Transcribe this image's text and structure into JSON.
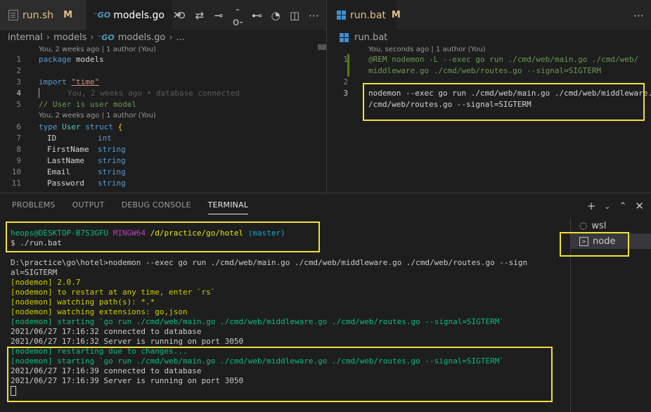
{
  "left_editor": {
    "tabs": [
      {
        "label": "run.sh",
        "mod": "M"
      },
      {
        "label": "models.go"
      }
    ],
    "toolbar_icons": [
      "history-icon",
      "compare-changes-icon",
      "git-commit-prev-icon",
      "git-commit-icon",
      "git-commit-next-icon",
      "timeline-icon",
      "split-editor-icon",
      "more-actions-icon"
    ],
    "breadcrumb": {
      "items": [
        "internal",
        "models",
        "models.go",
        "..."
      ]
    },
    "lens_top": "You, 2 weeks ago | 1 author (You)",
    "lens_mid": "You, 2 weeks ago | 1 author (You)",
    "ghost_blame": "You, 2 weeks ago • database connected",
    "line_numbers": [
      "1",
      "2",
      "3",
      "4",
      "5",
      "6",
      "7",
      "8",
      "9",
      "10",
      "11"
    ],
    "lines": {
      "l1_kw": "package",
      "l1_id": " models",
      "l3_kw": "import",
      "l3_str": "\"time\"",
      "l5_cm": "// User is user model",
      "l6_kw": "type",
      "l6_ty": " User",
      "l6_kw2": " struct",
      "l6_br": " {",
      "fields": [
        {
          "name": "ID",
          "type": "int"
        },
        {
          "name": "FirstName",
          "type": "string"
        },
        {
          "name": "LastName",
          "type": "string"
        },
        {
          "name": "Email",
          "type": "string"
        },
        {
          "name": "Password",
          "type": "string"
        }
      ]
    }
  },
  "right_editor": {
    "tab": {
      "label": "run.bat",
      "mod": "M"
    },
    "breadcrumb": "run.bat",
    "lens": "You, seconds ago | 1 author (You)",
    "line_numbers": [
      "1",
      "2",
      "3"
    ],
    "line1_a": "@REM nodemon -L --exec go run ./cmd/web/main.go ./cmd/web/",
    "line1_b": "middleware.go ./cmd/web/routes.go --signal=SIGTERM",
    "line3_a": "nodemon --exec go run ./cmd/web/main.go ./cmd/web/middleware.go .",
    "line3_b": "/cmd/web/routes.go --signal=SIGTERM"
  },
  "panel": {
    "tabs": [
      "PROBLEMS",
      "OUTPUT",
      "DEBUG CONSOLE",
      "TERMINAL"
    ],
    "prompt": {
      "user": "heops@DESKTOP-B7S3GFU",
      "shell": "MINGW64",
      "path": "/d/practice/go/hotel",
      "branch": "(master)"
    },
    "command": "$ ./run.bat",
    "output": {
      "cmd1": "D:\\practice\\go\\hotel>nodemon --exec go run ./cmd/web/main.go ./cmd/web/middleware.go ./cmd/web/routes.go --sign",
      "cmd2": "al=SIGTERM",
      "n1": "[nodemon] 2.0.7",
      "n2": "[nodemon] to restart at any time, enter `rs`",
      "n3": "[nodemon] watching path(s): *.*",
      "n4": "[nodemon] watching extensions: go,json",
      "n5": "[nodemon] starting `go run ./cmd/web/main.go ./cmd/web/middleware.go ./cmd/web/routes.go --signal=SIGTERM`",
      "l1": "2021/06/27 17:16:32 connected to database",
      "l2": "2021/06/27 17:16:32 Server is running on port 3050",
      "n6": "[nodemon] restarting due to changes...",
      "n7": "[nodemon] starting `go run ./cmd/web/main.go ./cmd/web/middleware.go ./cmd/web/routes.go --signal=SIGTERM`",
      "l3": "2021/06/27 17:16:39 connected to database",
      "l4": "2021/06/27 17:16:39 Server is running on port 3050"
    },
    "terminals": [
      {
        "label": "wsl"
      },
      {
        "label": "node"
      }
    ]
  }
}
